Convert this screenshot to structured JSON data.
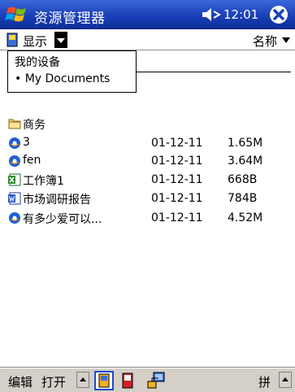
{
  "titlebar": {
    "title": "资源管理器",
    "time": "12:01"
  },
  "toolbar": {
    "show_label": "显示",
    "sort_label": "名称"
  },
  "folder_menu": {
    "items": [
      "我的设备",
      "• My Documents"
    ]
  },
  "files": [
    {
      "name": "商务",
      "date": "",
      "size": "",
      "icon": "folder-icon"
    },
    {
      "name": "3",
      "date": "01-12-11",
      "size": "1.65M",
      "icon": "media-file-icon"
    },
    {
      "name": "fen",
      "date": "01-12-11",
      "size": "3.64M",
      "icon": "media-file-icon"
    },
    {
      "name": "工作簿1",
      "date": "01-12-11",
      "size": "668B",
      "icon": "excel-file-icon"
    },
    {
      "name": "市场调研报告",
      "date": "01-12-11",
      "size": "784B",
      "icon": "word-file-icon"
    },
    {
      "name": "有多少爱可以...",
      "date": "01-12-11",
      "size": "4.52M",
      "icon": "media-file-icon"
    }
  ],
  "cmdbar": {
    "edit": "编辑",
    "open": "打开",
    "ime": "拼"
  }
}
